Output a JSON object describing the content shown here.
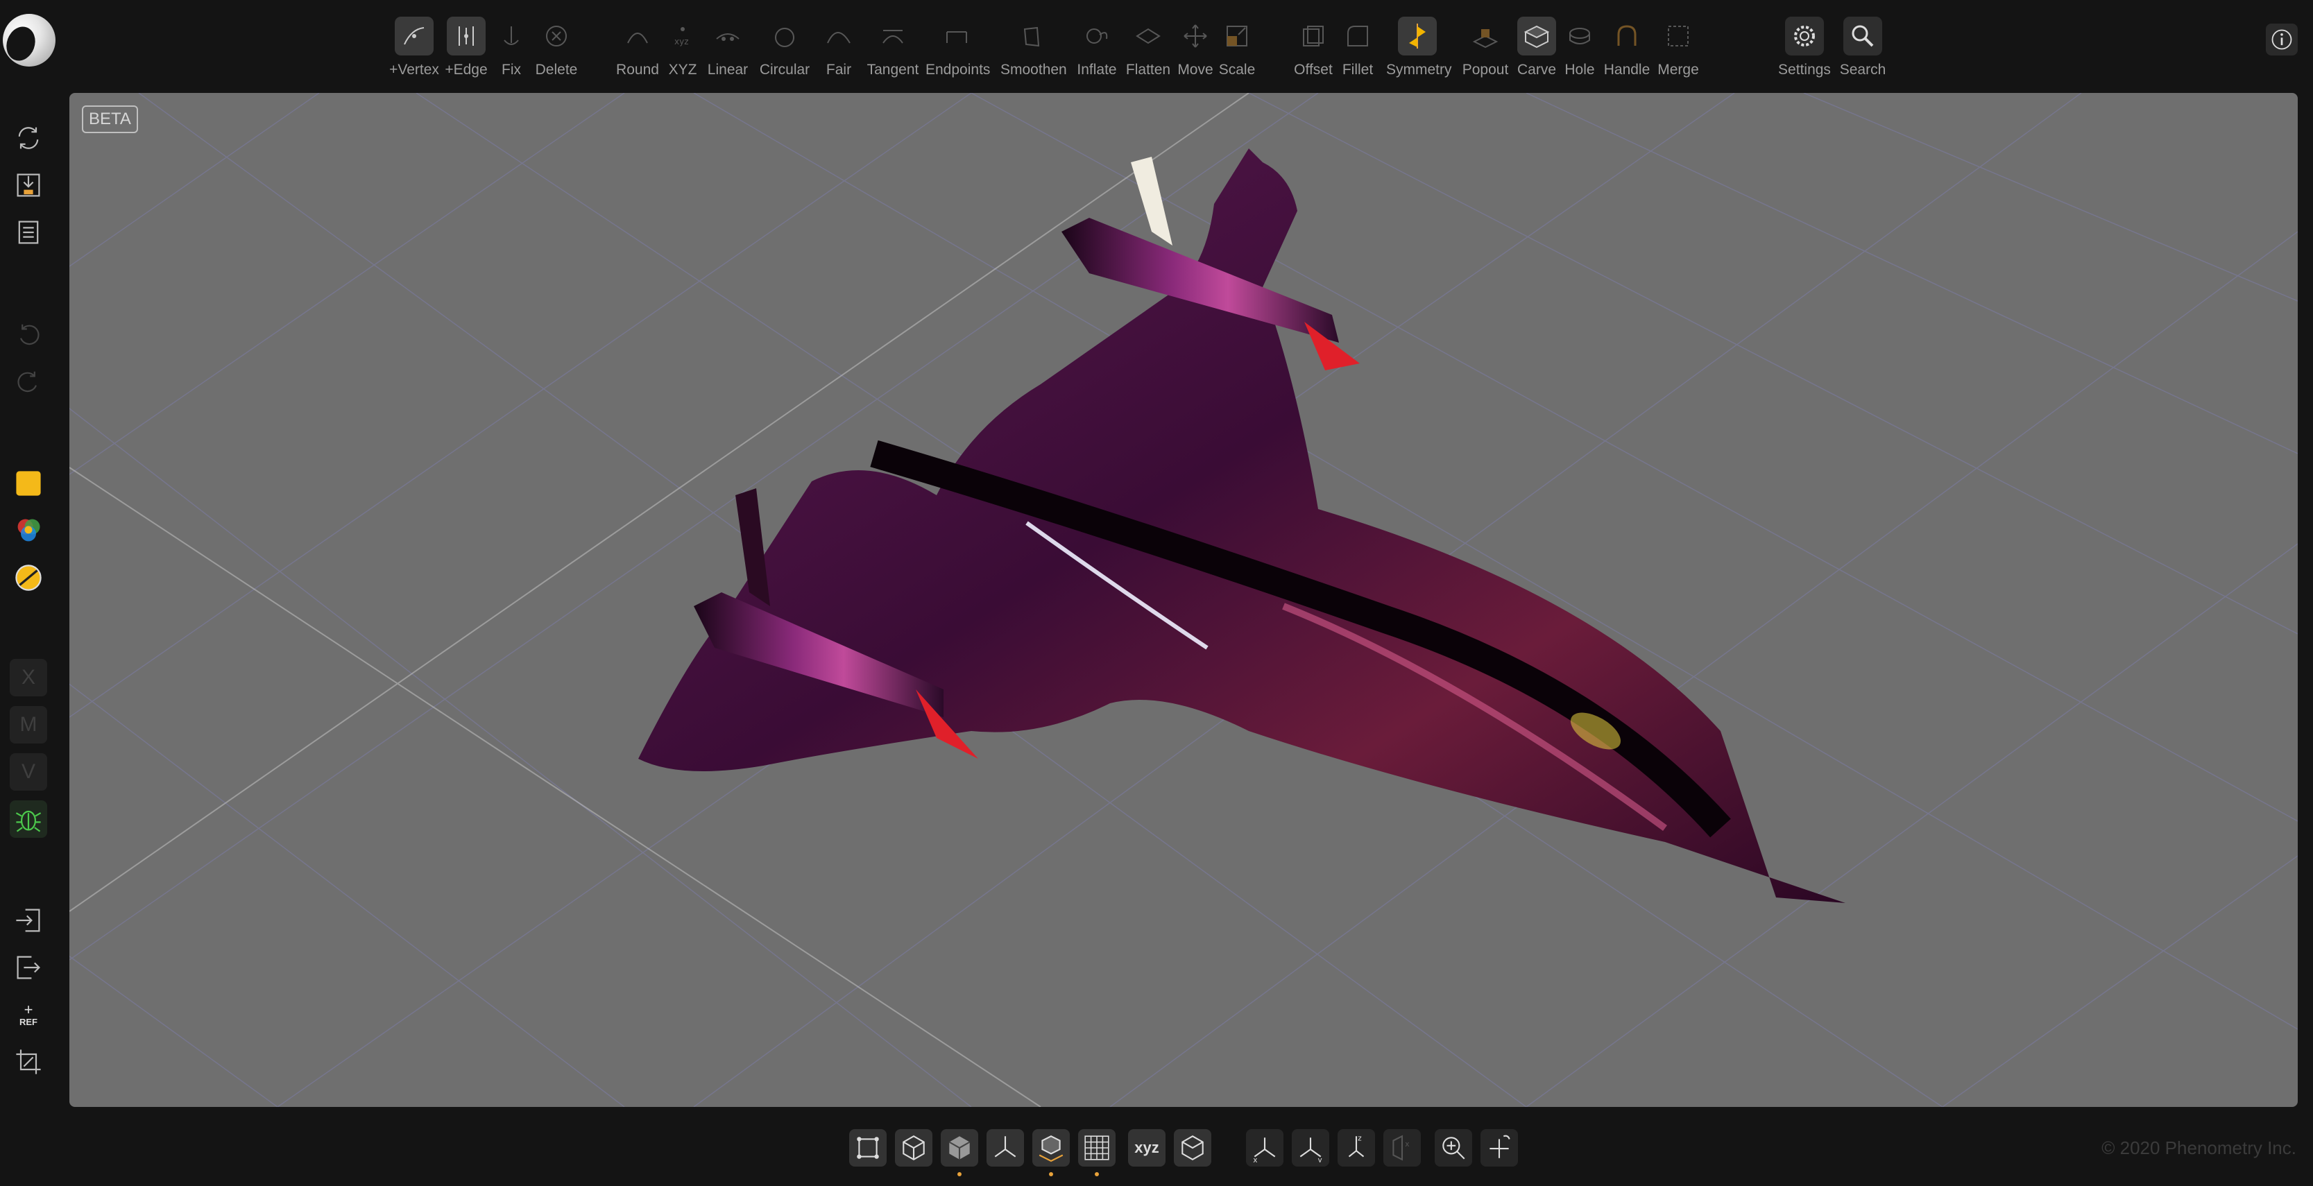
{
  "app": {
    "copyright": "© 2020 Phenometry Inc.",
    "beta_label": "BETA"
  },
  "toolbar": {
    "vertex": "+Vertex",
    "edge": "+Edge",
    "fix": "Fix",
    "delete": "Delete",
    "round": "Round",
    "xyz": "XYZ",
    "linear": "Linear",
    "circular": "Circular",
    "fair": "Fair",
    "tangent": "Tangent",
    "endpoints": "Endpoints",
    "smoothen": "Smoothen",
    "inflate": "Inflate",
    "flatten": "Flatten",
    "move": "Move",
    "scale": "Scale",
    "offset": "Offset",
    "fillet": "Fillet",
    "symmetry": "Symmetry",
    "popout": "Popout",
    "carve": "Carve",
    "hole": "Hole",
    "handle": "Handle",
    "merge": "Merge",
    "settings": "Settings",
    "search": "Search"
  },
  "sidebar": {
    "x": "X",
    "m": "M",
    "v": "V",
    "ref": "REF"
  },
  "bottombar": {
    "xyz": "xyz"
  },
  "colors": {
    "background": "#141414",
    "viewport": "#6f6f6f",
    "accent": "#e8a23a",
    "model": "#4a1540"
  }
}
